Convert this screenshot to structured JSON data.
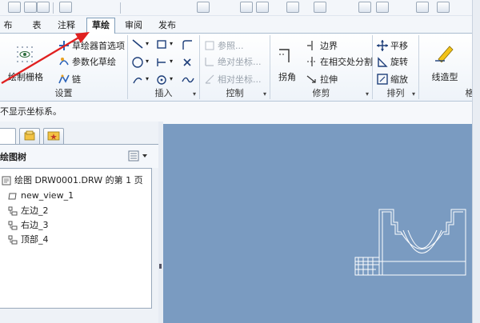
{
  "tabs": [
    {
      "label": "布局",
      "active": false
    },
    {
      "label": "表",
      "active": false
    },
    {
      "label": "注释",
      "active": false
    },
    {
      "label": "草绘",
      "active": true
    },
    {
      "label": "审阅",
      "active": false
    },
    {
      "label": "发布",
      "active": false
    }
  ],
  "ribbon": {
    "setup": {
      "title": "设置",
      "draw_grid": "绘制栅格",
      "sketcher_prefs": "草绘器首选项",
      "parametric_sketch": "参数化草绘",
      "chain": "链"
    },
    "insert": {
      "title": "插入"
    },
    "control": {
      "title": "控制",
      "reference": "参照...",
      "abs_coord": "绝对坐标...",
      "rel_coord": "相对坐标..."
    },
    "trim": {
      "title": "修剪",
      "corner": "拐角",
      "boundary": "边界",
      "split_at_intersect": "在相交处分割",
      "stretch": "拉伸"
    },
    "arrange": {
      "title": "排列",
      "translate": "平移",
      "rotate": "旋转",
      "scale": "缩放"
    },
    "format": {
      "line_style": "线造型",
      "cut_title": "格"
    }
  },
  "status_text": "不显示坐标系。",
  "tree": {
    "title": "绘图树",
    "items": [
      "绘图 DRW0001.DRW 的第 1 页",
      "new_view_1",
      "左边_2",
      "右边_3",
      "顶部_4"
    ]
  },
  "colors": {
    "canvas": "#7a9bc1",
    "annotation_arrow": "#e02020",
    "accent": "#2a62b8"
  },
  "icons": {
    "setup": [
      "grid-icon",
      "sketcher-preferences-icon",
      "parametric-sketch-icon",
      "chain-icon"
    ],
    "arrange": [
      "move-icon",
      "rotate-icon",
      "scale-icon"
    ]
  }
}
